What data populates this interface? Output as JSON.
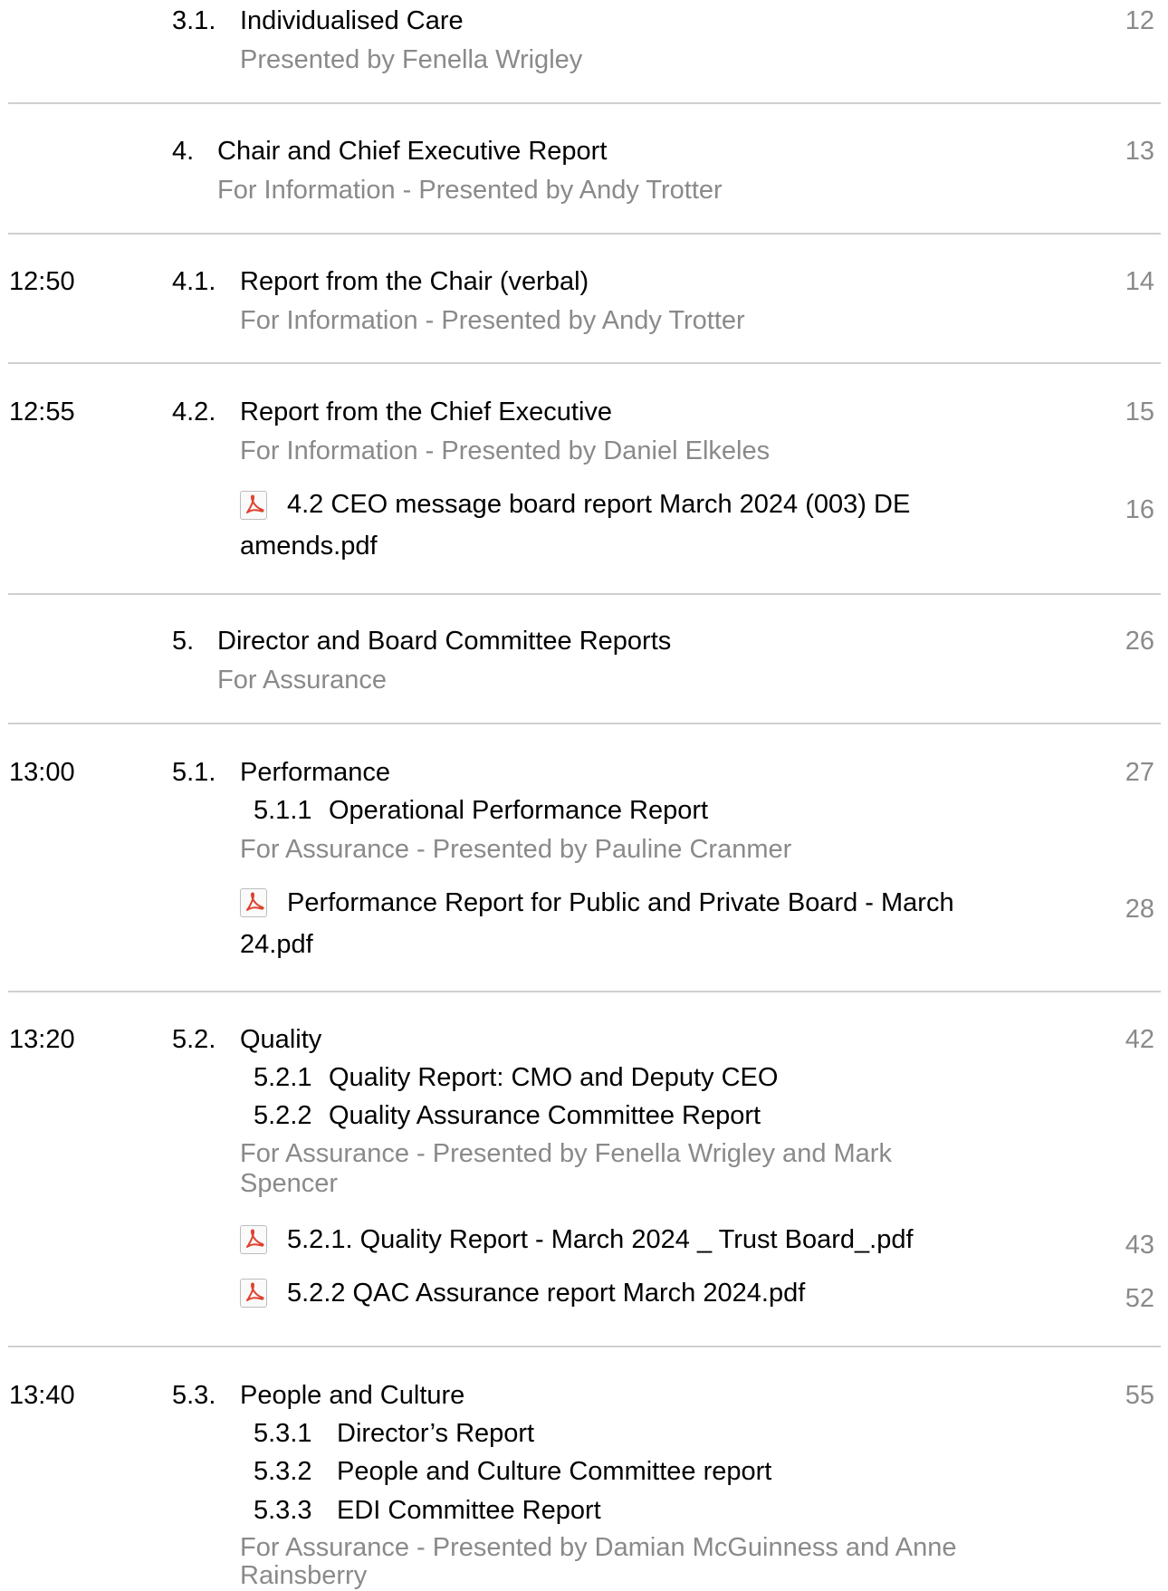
{
  "items": [
    {
      "num": "3.1.",
      "title": "Individualised Care",
      "sub": "Presented by Fenella Wrigley",
      "page": "12"
    },
    {
      "num": "4.",
      "title": "Chair and Chief Executive Report",
      "sub": "For Information - Presented by Andy Trotter",
      "page": "13"
    },
    {
      "time": "12:50",
      "num": "4.1.",
      "title": "Report from the Chair (verbal)",
      "sub": "For Information - Presented by Andy Trotter",
      "page": "14"
    },
    {
      "time": "12:55",
      "num": "4.2.",
      "title": "Report from the Chief Executive",
      "sub": "For Information - Presented by Daniel Elkeles",
      "page": "15",
      "attachment": {
        "line1": "4.2 CEO message board report March 2024 (003) DE",
        "line2": "amends.pdf",
        "page": "16"
      }
    },
    {
      "num": "5.",
      "title": "Director and Board Committee Reports",
      "sub": "For Assurance",
      "page": "26"
    },
    {
      "time": "13:00",
      "num": "5.1.",
      "title": "Performance",
      "page": "27",
      "subitems": [
        {
          "num": "5.1.1",
          "title": "Operational Performance Report"
        }
      ],
      "sub": "For Assurance - Presented by Pauline Cranmer",
      "attachment": {
        "line1": "Performance Report for Public and Private Board - March",
        "line2": "24.pdf",
        "page": "28"
      }
    },
    {
      "time": "13:20",
      "num": "5.2.",
      "title": "Quality",
      "page": "42",
      "subitems": [
        {
          "num": "5.2.1",
          "title": "Quality Report: CMO and Deputy CEO"
        },
        {
          "num": "5.2.2",
          "title": "Quality Assurance Committee Report"
        }
      ],
      "sub_line1": "For Assurance - Presented by Fenella Wrigley and Mark",
      "sub_line2": "Spencer",
      "attachments": [
        {
          "name": "5.2.1. Quality Report - March 2024 _ Trust Board_.pdf",
          "page": "43"
        },
        {
          "name": "5.2.2 QAC Assurance report March 2024.pdf",
          "page": "52"
        }
      ]
    },
    {
      "time": "13:40",
      "num": "5.3.",
      "title": "People and Culture",
      "page": "55",
      "subitems": [
        {
          "num": "5.3.1",
          "title": "Director’s Report"
        },
        {
          "num": "5.3.2",
          "title": "People and Culture Committee report"
        },
        {
          "num": "5.3.3",
          "title": "EDI Committee Report"
        }
      ],
      "sub_line1": "For Assurance - Presented by Damian McGuinness and Anne",
      "sub_line2": "Rainsberry"
    }
  ],
  "icons": {
    "attachment": "pdf-icon"
  },
  "colors": {
    "muted": "#8a8a8a",
    "rule": "#cfcfcf",
    "pdf": "#e0412e"
  }
}
